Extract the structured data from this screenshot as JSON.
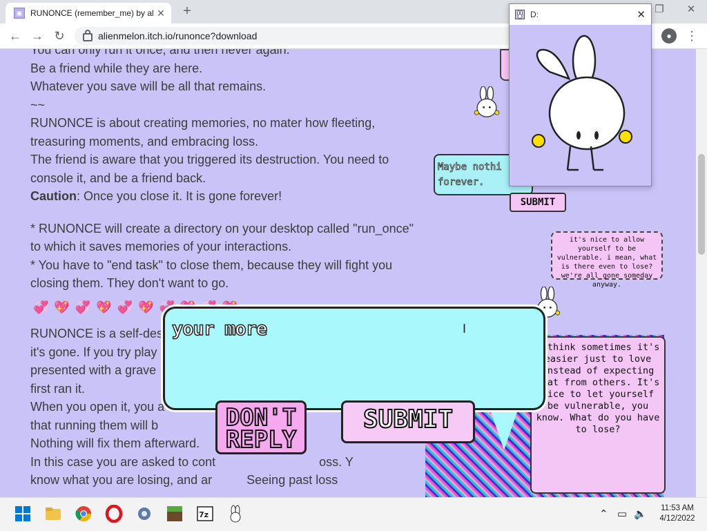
{
  "browser": {
    "tab_title": "RUNONCE (remember_me) by al",
    "tab_close": "✕",
    "new_tab": "+",
    "url": "alienmelon.itch.io/runonce?download",
    "win_minimize": "—",
    "win_restore": "❐",
    "win_close": "✕"
  },
  "article": {
    "line_top": "You can only run it once, and then never again.",
    "line_friend": "Be a friend while they are here.",
    "line_save": "Whatever you save will be all that remains.",
    "divider": "~~",
    "para_memories": "RUNONCE is about creating memories, no mater how fleeting, treasuring moments, and embracing loss.",
    "para_console": "The friend is aware that you triggered its destruction. You need to console it, and be a friend back.",
    "caution_label": "Caution",
    "caution_text": ": Once you close it. It is gone forever!",
    "bullet_dir": "* RUNONCE will create a directory on your desktop called \"run_once\" to which it saves memories of your interactions.",
    "bullet_end": "* You have to \"end task\" to close them, because they will fight you closing them. They don't want to go.",
    "hearts": "💞💖💞💖💞💖💞💖💞💖",
    "p3_1": "RUNONCE is a self-destructive game. You can't play it again once",
    "p3_2": "it's gone. If you try play",
    "p3_3": "presented with a grave",
    "p3_4": "first ran it.",
    "p3_5": "When you open it, you a",
    "p3_6": "that running them will b",
    "p3_7": "Nothing will fix them afterward.",
    "p3_8": "In this case you are asked to cont",
    "p3_8b": "oss. Y",
    "p3_9": "know what you are losing, and ar",
    "p3_9b": "Seeing past loss"
  },
  "stickers": {
    "bubble_top_text": "Maybe nothi forever.",
    "bubble_top_submit": "SUBMIT",
    "pink_note_small": "it's nice to allow yourself to be vulnerable. i mean, what is there even to lose? we're all gone someday anyway.",
    "pink_note_large": "I think sometimes it's easier just to love instead of expecting that from others. It's nice to let yourself be vulnerable, you know. What do you have to lose?"
  },
  "dialog": {
    "typed_text": "your more",
    "dont_reply_label": "DON'T REPLY",
    "submit_label": "SUBMIT"
  },
  "popup_window": {
    "title": "D:",
    "close": "✕"
  },
  "taskbar": {
    "time": "11:53 AM",
    "date": "4/12/2022"
  },
  "colors": {
    "page_bg": "#c9c3f7",
    "dialog_bg": "#a9f8fb",
    "pink": "#f7a9ef",
    "bubble_cyan": "#a9f1f6"
  }
}
